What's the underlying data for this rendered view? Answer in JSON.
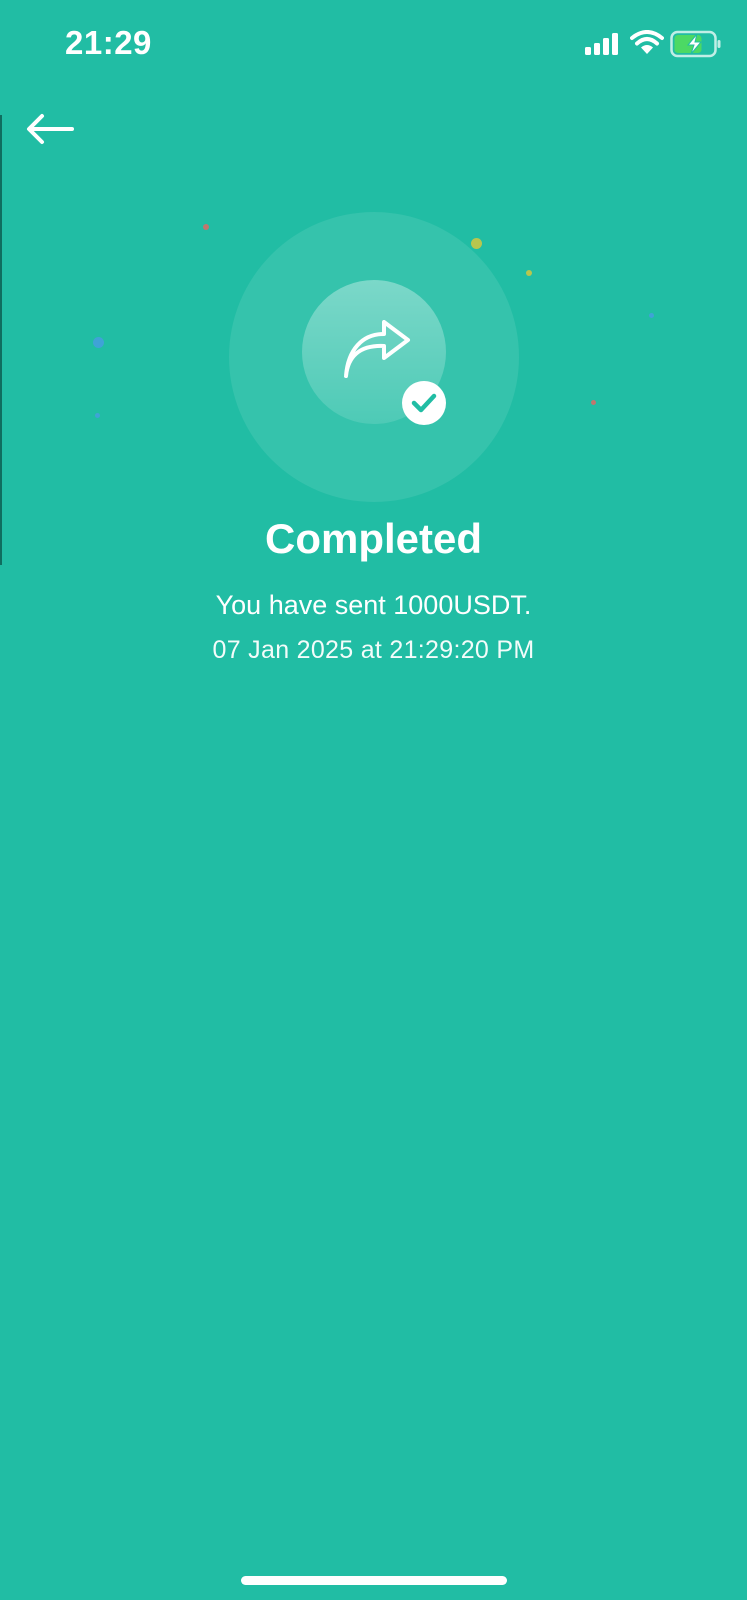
{
  "status_bar": {
    "time": "21:29",
    "signal_icon": "cellular-signal-icon",
    "wifi_icon": "wifi-icon",
    "battery_icon": "battery-charging-icon",
    "battery_color": "#4CD964"
  },
  "nav": {
    "back_icon": "arrow-left-icon"
  },
  "result": {
    "icon": "share-forward-icon",
    "badge_icon": "checkmark-icon",
    "title": "Completed",
    "message": "You have sent 1000USDT.",
    "timestamp": "07 Jan 2025 at 21:29:20 PM"
  },
  "colors": {
    "background": "#21BDA4",
    "text": "#FFFFFF"
  }
}
